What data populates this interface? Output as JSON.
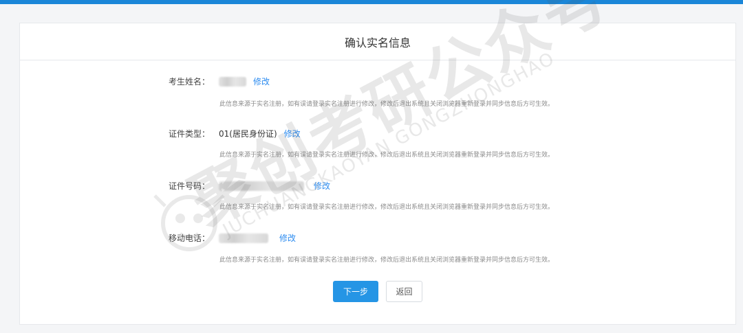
{
  "page_title": "确认实名信息",
  "fields": [
    {
      "label": "考生姓名：",
      "value": "",
      "edit_label": "修改",
      "masked": true
    },
    {
      "label": "证件类型：",
      "value": "01(居民身份证)",
      "edit_label": "修改",
      "masked": false
    },
    {
      "label": "证件号码：",
      "value": "",
      "edit_label": "修改",
      "masked": true
    },
    {
      "label": "移动电话：",
      "value": "",
      "edit_label": "修改",
      "masked": true
    }
  ],
  "note_text": "此信息来源于实名注册，如有误请登录实名注册进行修改，修改后退出系统且关闭浏览器重新登录并同步信息后方可生效。",
  "buttons": {
    "next": "下一步",
    "back": "返回"
  },
  "watermark": {
    "main": "聚创考研公众号",
    "sub": "JUCHUANGKAOYAN GONGZHONGHAO"
  },
  "colors": {
    "accent": "#2595e5",
    "link": "#2d8cf0",
    "topbar": "#1a86d8"
  }
}
